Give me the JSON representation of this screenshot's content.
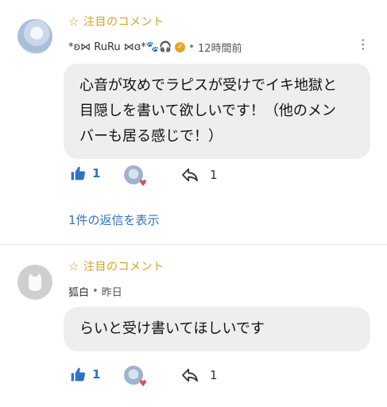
{
  "comments": [
    {
      "badge": "注目のコメント",
      "author": "*ʚ⋈ RuRu ⋈ɞ*🐾🎧",
      "time": "12時間前",
      "text_line1": "心音が攻めでラピスが受けでイキ地獄と",
      "text_line2": "目隠しを書いて欲しいです！（他のメン",
      "text_line3": "バーも居る感じで！）",
      "likes": "1",
      "replies_count": "1",
      "view_replies": "1件の返信を表示"
    },
    {
      "badge": "注目のコメント",
      "author": "狐白",
      "time": "昨日",
      "text_line1": "らいと受け書いてほしいです",
      "likes": "1",
      "replies_count": "1"
    }
  ],
  "icons": [
    "star-icon",
    "verified-icon",
    "more-options-icon",
    "thumbs-up-icon",
    "creator-heart-icon",
    "reply-icon"
  ],
  "colors": {
    "badge": "#d2a227",
    "accent": "#2f73c6",
    "bubble": "#eeeeee",
    "heart": "#e05050"
  }
}
